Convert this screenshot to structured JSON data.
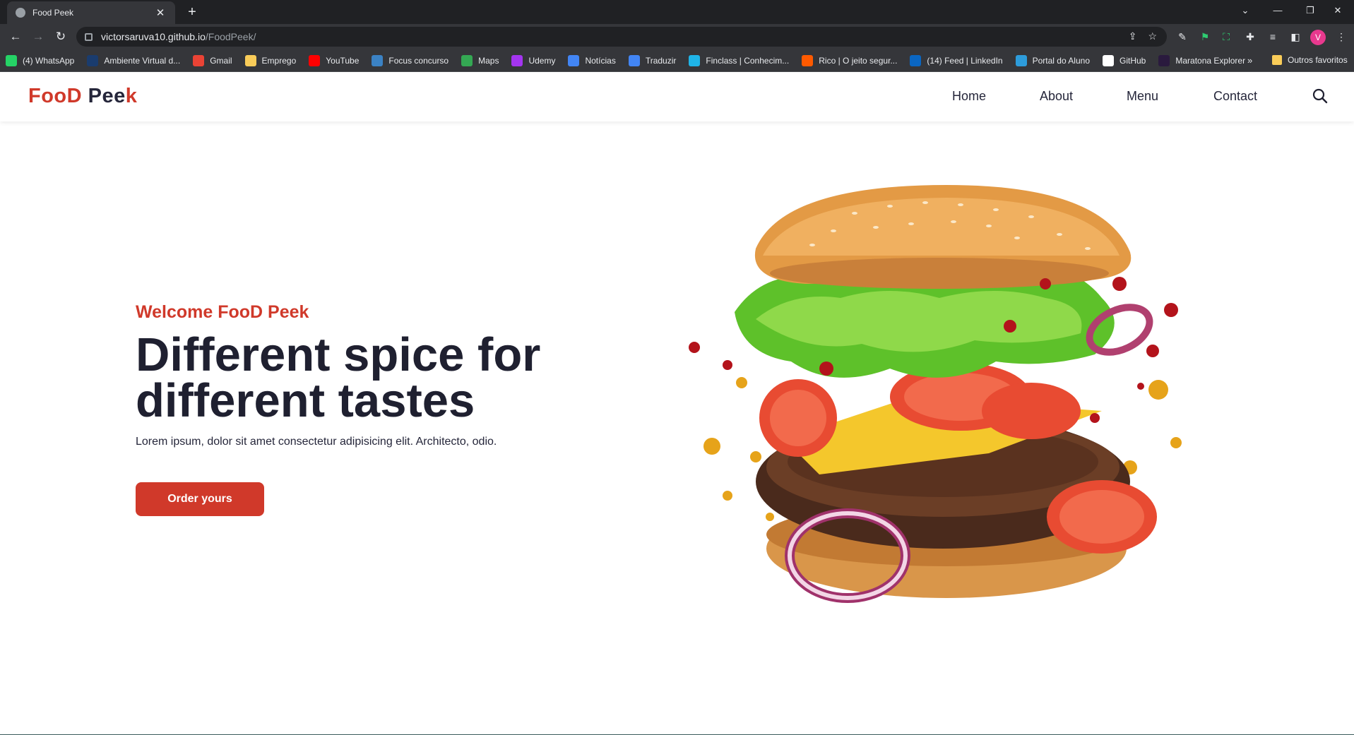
{
  "browser": {
    "tab_title": "Food Peek",
    "url_host": "victorsaruva10.github.io",
    "url_path": "/FoodPeek/",
    "avatar_letter": "V",
    "bookmarks": [
      {
        "label": "(4) WhatsApp",
        "color": "#25d366"
      },
      {
        "label": "Ambiente Virtual d...",
        "color": "#1a3c6e"
      },
      {
        "label": "Gmail",
        "color": "#ea4335"
      },
      {
        "label": "Emprego",
        "color": "#f9cc59"
      },
      {
        "label": "YouTube",
        "color": "#ff0000"
      },
      {
        "label": "Focus concurso",
        "color": "#3b82c4"
      },
      {
        "label": "Maps",
        "color": "#34a853"
      },
      {
        "label": "Udemy",
        "color": "#a435f0"
      },
      {
        "label": "Notícias",
        "color": "#4285f4"
      },
      {
        "label": "Traduzir",
        "color": "#4285f4"
      },
      {
        "label": "Finclass | Conhecim...",
        "color": "#1fb4e8"
      },
      {
        "label": "Rico | O jeito segur...",
        "color": "#ff5a00"
      },
      {
        "label": "(14) Feed | LinkedIn",
        "color": "#0a66c2"
      },
      {
        "label": "Portal do Aluno",
        "color": "#2d9cdb"
      },
      {
        "label": "GitHub",
        "color": "#ffffff"
      },
      {
        "label": "Maratona Explorer",
        "color": "#2a1a3e"
      }
    ],
    "bookmarks_more": "»",
    "other_bookmarks": "Outros favoritos"
  },
  "site": {
    "logo": {
      "part1": "Foo",
      "part2": "D",
      "part3": " Pee",
      "part4": "k"
    },
    "nav": [
      "Home",
      "About",
      "Menu",
      "Contact"
    ],
    "hero": {
      "subtitle": "Welcome FooD Peek",
      "title": "Different spice for different tastes",
      "description": "Lorem ipsum, dolor sit amet consectetur adipisicing elit. Architecto, odio.",
      "button": "Order yours"
    },
    "colors": {
      "accent": "#d0392a",
      "text": "#1f2030"
    }
  }
}
